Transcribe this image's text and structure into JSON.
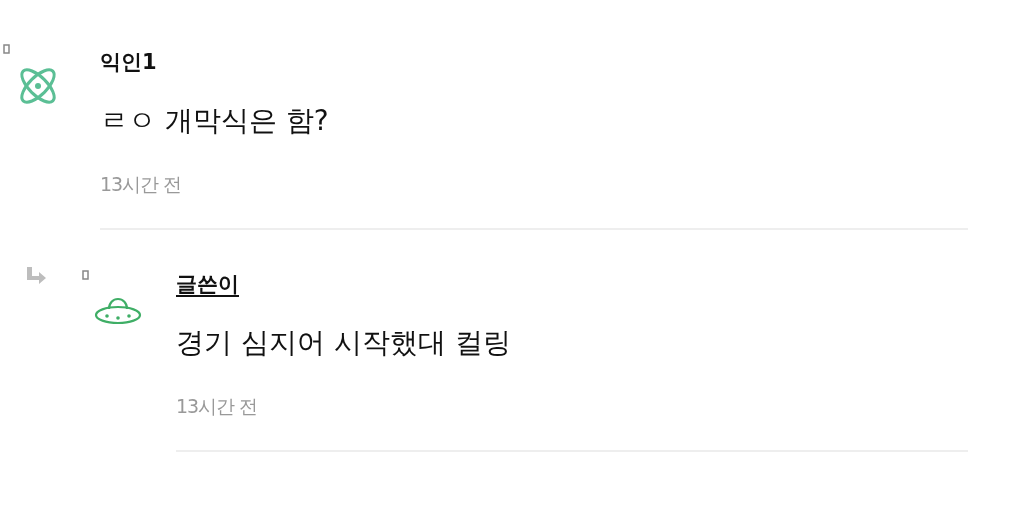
{
  "comments": [
    {
      "kind": "comment",
      "avatar": {
        "kind": "atom"
      },
      "author": "익인1",
      "is_writer": false,
      "text": "ㄹㅇ 개막식은 함?",
      "time": "13시간 전"
    },
    {
      "kind": "reply",
      "avatar": {
        "kind": "ufo"
      },
      "author": "글쓴이",
      "is_writer": true,
      "text": "경기 심지어 시작했대 컬링",
      "time": "13시간 전"
    }
  ]
}
